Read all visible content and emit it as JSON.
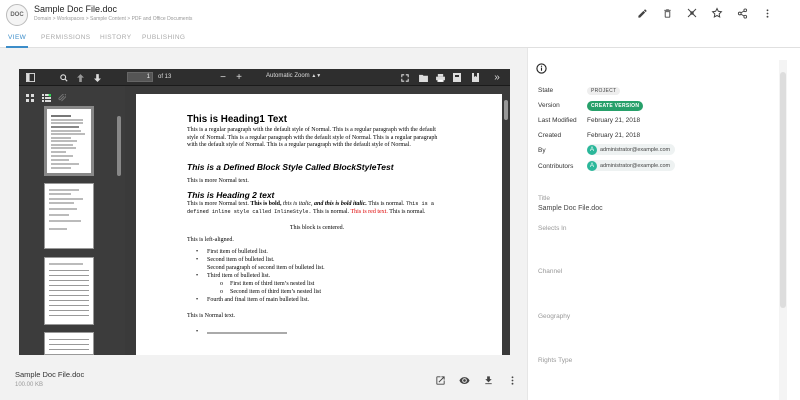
{
  "header": {
    "icon_text": "DOC",
    "title": "Sample Doc File.doc",
    "breadcrumb": "Domain > Workspaces > Sample Content > PDF and Office Documents",
    "icons": [
      "edit-icon",
      "delete-icon",
      "share-network-icon",
      "favorite-star-icon",
      "share-icon",
      "more-vert-icon"
    ]
  },
  "tabs": [
    {
      "label": "VIEW",
      "active": true
    },
    {
      "label": "PERMISSIONS",
      "active": false
    },
    {
      "label": "HISTORY",
      "active": false
    },
    {
      "label": "PUBLISHING",
      "active": false
    }
  ],
  "viewer": {
    "page_number": "1",
    "page_count": "of 13",
    "zoom_label": "Automatic Zoom",
    "zoom_out": "−",
    "zoom_in": "+"
  },
  "document": {
    "h1": "This is Heading1 Text",
    "p1": "This is a regular paragraph with the default style of Normal. This is a regular paragraph with the default style of Normal. This is a regular paragraph with the default style of Normal. This is a regular paragraph with the default style of Normal. This is a regular paragraph with the default style of Normal.",
    "block_style": "This is a Defined Block Style Called BlockStyleTest",
    "more_normal": "This is more Normal text.",
    "h2": "This is Heading 2 text",
    "p2_a": "This is more Normal text.",
    "p2_bold": "This is bold,",
    "p2_italic": "this is italic,",
    "p2_bolditalic": "and this is bold italic.",
    "p2_b": "This is normal.",
    "p2_mono": "This is a defined inline style called InlineStyle.",
    "p2_c": "This is normal.",
    "p2_red": "This is red text.",
    "p2_d": "This is normal.",
    "centered": "This block is centered.",
    "left_aligned": "This is left-aligned.",
    "bullets": [
      "First item of bulleted list.",
      "Second item of bulleted list.",
      "Second paragraph of second item of bulleted list.",
      "Third item of bulleted list."
    ],
    "nested": [
      "First item of third item’s nested list",
      "Second item of third item’s nested list"
    ],
    "last_bullet": "Fourth and final item of main bulleted list.",
    "normal_end": "This is Normal text."
  },
  "footer": {
    "file_name": "Sample Doc File.doc",
    "file_size": "100.00 KB"
  },
  "properties": {
    "state_label": "State",
    "state_value": "PROJECT",
    "version_label": "Version",
    "version_button": "CREATE VERSION",
    "modified_label": "Last Modified",
    "modified_value": "February 21, 2018",
    "created_label": "Created",
    "created_value": "February 21, 2018",
    "by_label": "By",
    "by_value": "administrator@example.com",
    "contributors_label": "Contributors",
    "contributors_value": "administrator@example.com",
    "avatar_letter": "A"
  },
  "fields": [
    {
      "label": "Title",
      "value": "Sample Doc File.doc"
    },
    {
      "label": "Selects In",
      "value": ""
    },
    {
      "label": "Channel",
      "value": ""
    },
    {
      "label": "Geography",
      "value": ""
    },
    {
      "label": "Rights Type",
      "value": ""
    }
  ],
  "colors": {
    "accent": "#3c8dc9",
    "version_green": "#27a06a",
    "avatar": "#2bb79a",
    "red_text": "#dd0000"
  }
}
